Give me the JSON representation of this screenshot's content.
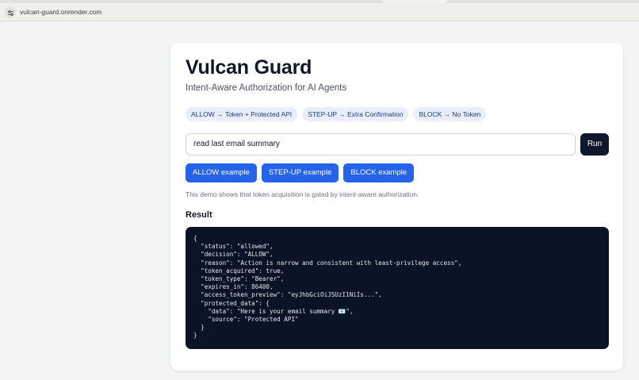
{
  "browser": {
    "url": "vulcan-guard.onrender.com"
  },
  "app": {
    "title": "Vulcan Guard",
    "subtitle": "Intent-Aware Authorization for AI Agents",
    "pills": [
      "ALLOW → Token + Protected API",
      "STEP-UP → Extra Confirmation",
      "BLOCK → No Token"
    ],
    "input_value": "read last email summary",
    "run_label": "Run",
    "examples": [
      "ALLOW example",
      "STEP-UP example",
      "BLOCK example"
    ],
    "note": "This demo shows that token acquisition is gated by intent-aware authorization.",
    "result_heading": "Result",
    "result_json": "{\n  \"status\": \"allowed\",\n  \"decision\": \"ALLOW\",\n  \"reason\": \"Action is narrow and consistent with least-privilege access\",\n  \"token_acquired\": true,\n  \"token_type\": \"Bearer\",\n  \"expires_in\": 86400,\n  \"access_token_preview\": \"eyJhbGciOiJSUzI1NiIs...\",\n  \"protected_data\": {\n    \"data\": \"Here is your email summary 📧\",\n    \"source\": \"Protected API\"\n  }\n}"
  },
  "icons": {
    "site_info": "tune-icon"
  },
  "colors": {
    "primary": "#2563eb",
    "dark": "#0f172a",
    "code_bg": "#0b1426",
    "pill_bg": "#e8eefb"
  }
}
